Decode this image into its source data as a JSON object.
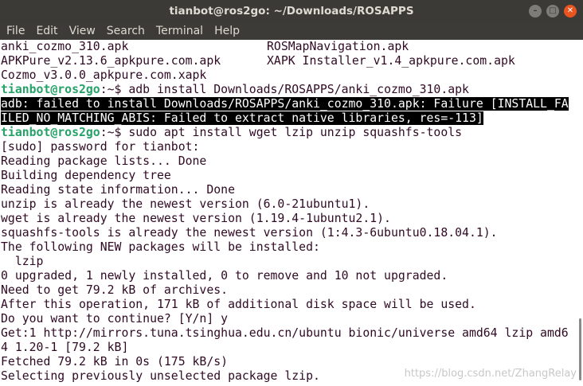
{
  "window": {
    "title": "tianbot@ros2go: ~/Downloads/ROSAPPS"
  },
  "menu": [
    "File",
    "Edit",
    "View",
    "Search",
    "Terminal",
    "Help"
  ],
  "terminal": {
    "listing": [
      [
        "anki_cozmo_310.apk",
        "ROSMapNavigation.apk"
      ],
      [
        "APKPure_v2.13.6_apkpure.com.apk",
        "XAPK Installer_v1.4_apkpure.com.apk"
      ],
      [
        "Cozmo_v3.0.0_apkpure.com.xapk",
        ""
      ]
    ],
    "prompt_user": "tianbot@ros2go",
    "prompt_path": ":~$ ",
    "cmd1": "adb install Downloads/ROSAPPS/anki_cozmo_310.apk",
    "error_line1": "adb: failed to install Downloads/ROSAPPS/anki_cozmo_310.apk: Failure [INSTALL_FA",
    "error_line2": "ILED_NO_MATCHING_ABIS: Failed to extract native libraries, res=-113]",
    "cmd2": "sudo apt install wget lzip unzip squashfs-tools",
    "output": [
      "[sudo] password for tianbot:",
      "Reading package lists... Done",
      "Building dependency tree",
      "Reading state information... Done",
      "unzip is already the newest version (6.0-21ubuntu1).",
      "wget is already the newest version (1.19.4-1ubuntu2.1).",
      "squashfs-tools is already the newest version (1:4.3-6ubuntu0.18.04.1).",
      "The following NEW packages will be installed:",
      "  lzip",
      "0 upgraded, 1 newly installed, 0 to remove and 10 not upgraded.",
      "Need to get 79.2 kB of archives.",
      "After this operation, 171 kB of additional disk space will be used.",
      "Do you want to continue? [Y/n] y",
      "Get:1 http://mirrors.tuna.tsinghua.edu.cn/ubuntu bionic/universe amd64 lzip amd6",
      "4 1.20-1 [79.2 kB]",
      "Fetched 79.2 kB in 0s (175 kB/s)",
      "Selecting previously unselected package lzip."
    ]
  },
  "watermark": "https://blog.csdn.net/ZhangRelay"
}
